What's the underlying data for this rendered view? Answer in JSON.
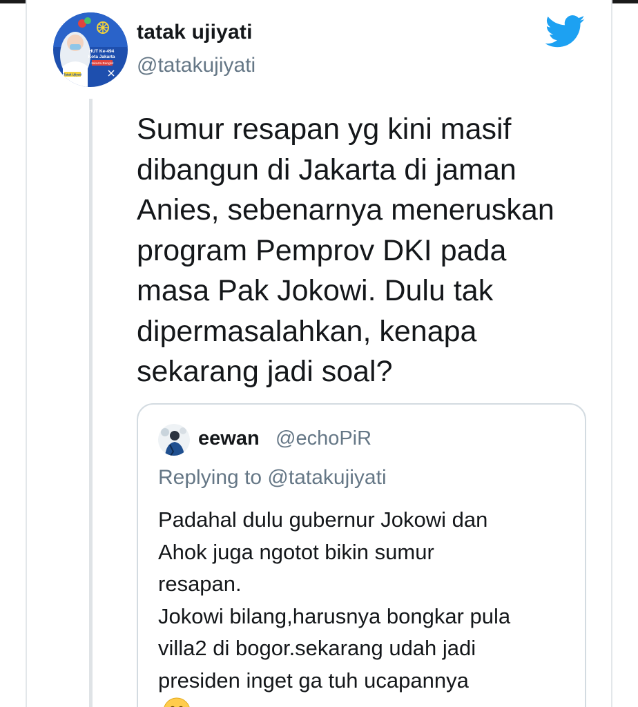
{
  "tweet": {
    "display_name": "tatak ujiyati",
    "handle": "@tatakujiyati",
    "avatar_text": {
      "line1": "HUT Ke-494",
      "line2": "Kota Jakarta",
      "line3": "Jakarta Bangkit",
      "line4": "Tatak Ujiyati"
    },
    "text_lines": [
      "Sumur resapan yg kini masif",
      "dibangun di Jakarta di jaman",
      "Anies, sebenarnya meneruskan",
      "program Pemprov DKI pada",
      "masa Pak Jokowi. Dulu tak",
      "dipermasalahkan, kenapa",
      "sekarang jadi soal?"
    ]
  },
  "quoted_tweet": {
    "display_name": "eewan",
    "handle": "@echoPiR",
    "replying_to": "Replying to @tatakujiyati",
    "text_lines": [
      "Padahal dulu gubernur Jokowi dan",
      "Ahok juga ngotot bikin sumur",
      "resapan.",
      "Jokowi bilang,harusnya bongkar pula",
      "villa2 di bogor.sekarang udah jadi",
      "presiden inget ga tuh ucapannya"
    ],
    "emoji": "grinning-face-with-smiling-eyes-icon"
  },
  "colors": {
    "twitter_blue": "#1da1f2",
    "text_primary": "#14171a",
    "text_secondary": "#657786",
    "border": "#d3dbe1"
  }
}
